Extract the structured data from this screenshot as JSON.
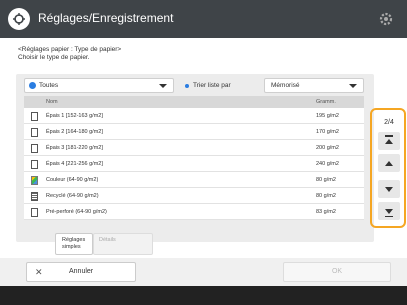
{
  "header": {
    "title": "Réglages/Enregistrement",
    "icon": "settings-wrench-icon",
    "gear_icon": "gear-icon"
  },
  "instructions": {
    "line1": "<Réglages papier : Type de papier>",
    "line2": "Choisir le type de papier."
  },
  "filter": {
    "selected": "Toutes"
  },
  "sort": {
    "label": "Trier liste par",
    "selected": "Mémorisé"
  },
  "table": {
    "headers": {
      "name": "Nom",
      "thickness": "Gramm."
    },
    "rows": [
      {
        "name": "Épais 1 [152-163 g/m2]",
        "thickness": "195 g/m2",
        "icon": "paper"
      },
      {
        "name": "Épais 2 [164-180 g/m2]",
        "thickness": "170 g/m2",
        "icon": "paper"
      },
      {
        "name": "Épais 3 [181-220 g/m2]",
        "thickness": "200 g/m2",
        "icon": "paper"
      },
      {
        "name": "Épais 4 [221-256 g/m2]",
        "thickness": "240 g/m2",
        "icon": "paper"
      },
      {
        "name": "Couleur (64-90 g/m2)",
        "thickness": "80 g/m2",
        "icon": "color"
      },
      {
        "name": "Recyclé (64-90 g/m2)",
        "thickness": "80 g/m2",
        "icon": "recycled"
      },
      {
        "name": "Pré-perforé (64-90 g/m2)",
        "thickness": "83 g/m2",
        "icon": "paper"
      }
    ]
  },
  "scroll": {
    "count": "2/4"
  },
  "buttons": {
    "simple": "Réglages simples",
    "detail": "Détails",
    "cancel": "Annuler",
    "ok": "OK"
  },
  "colors": {
    "titlebar": "#3f4448",
    "highlight": "#f5a623",
    "accent": "#2a7de1"
  }
}
